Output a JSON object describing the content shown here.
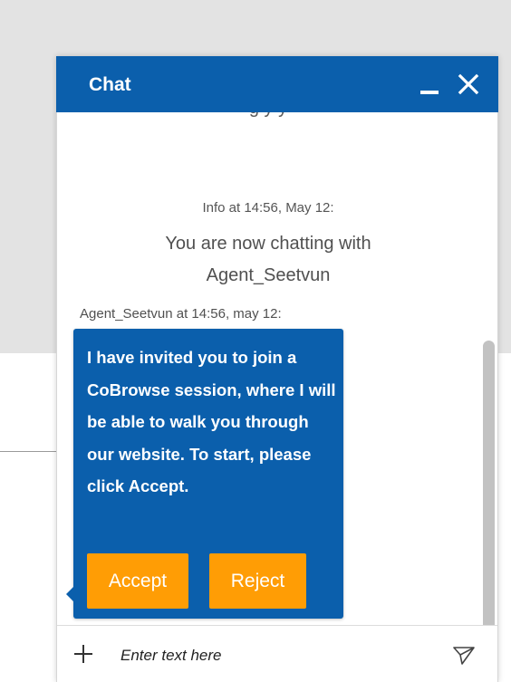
{
  "chat": {
    "title": "Chat",
    "partial_previous_message": "g                    y           y",
    "info_meta": "Info at 14:56, May 12:",
    "info_message": "You are now chatting with Agent_Seetvun",
    "agent_meta": "Agent_Seetvun at 14:56, may 12:",
    "agent_message": "I have invited you to join a CoBrowse session, where I will be able to walk you through our website. To start, please click Accept.",
    "accept_label": "Accept",
    "reject_label": "Reject",
    "input_placeholder": "Enter text here"
  },
  "icons": {
    "minimize": "minimize-icon",
    "close": "close-icon",
    "attach": "plus-icon",
    "send": "send-icon"
  },
  "colors": {
    "header": "#0b5fac",
    "agent_bubble": "#0b5fac",
    "action_button": "#ff9d05",
    "page_background": "#e3e3e3"
  }
}
